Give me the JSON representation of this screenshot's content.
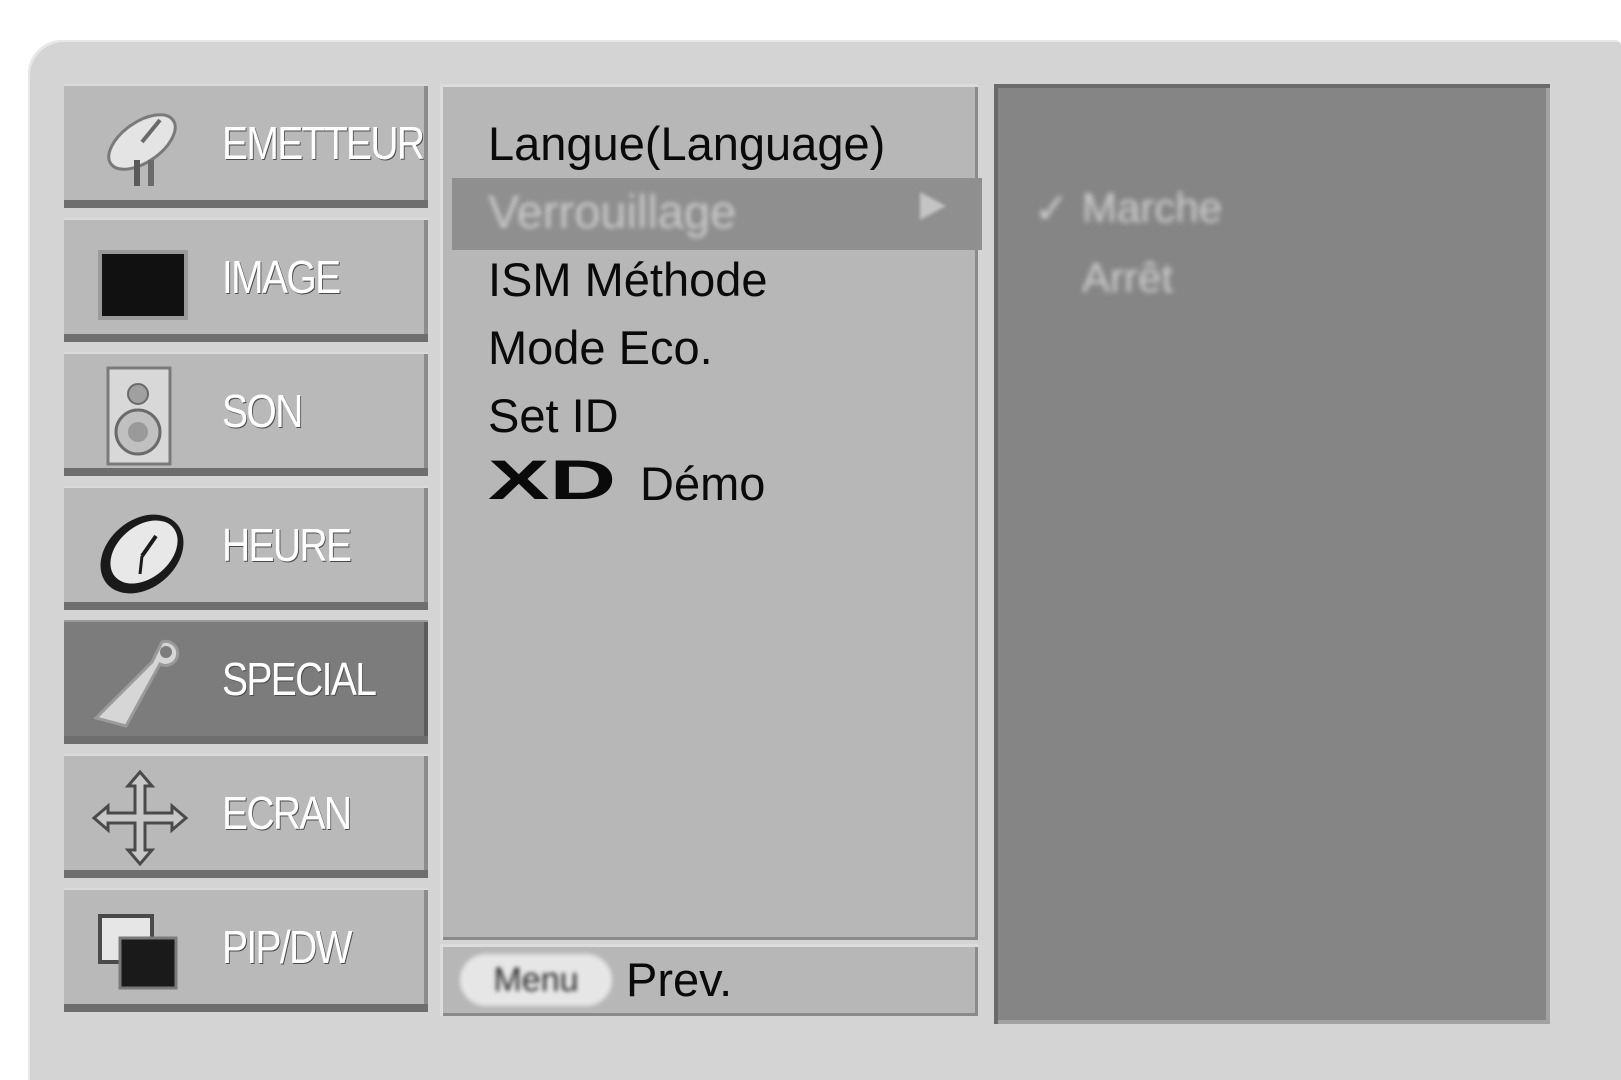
{
  "categories": [
    {
      "label": "EMETTEUR",
      "icon": "satellite-dish-icon",
      "active": false
    },
    {
      "label": "IMAGE",
      "icon": "tv-screen-icon",
      "active": false
    },
    {
      "label": "SON",
      "icon": "speaker-icon",
      "active": false
    },
    {
      "label": "HEURE",
      "icon": "clock-icon",
      "active": false
    },
    {
      "label": "SPECIAL",
      "icon": "tag-icon",
      "active": true
    },
    {
      "label": "ECRAN",
      "icon": "move-arrows-icon",
      "active": false
    },
    {
      "label": "PIP/DW",
      "icon": "pip-windows-icon",
      "active": false
    }
  ],
  "menu": {
    "items": [
      {
        "label": "Langue(Language)"
      },
      {
        "label": "Verrouillage",
        "highlighted": true
      },
      {
        "label": "ISM Méthode"
      },
      {
        "label": "Mode Eco."
      },
      {
        "label": "Set ID"
      },
      {
        "label": "Démo",
        "logo": "XD"
      }
    ]
  },
  "footer": {
    "key_label": "Menu",
    "action_label": "Prev."
  },
  "options": {
    "items": [
      {
        "label": "Marche",
        "checked": true
      },
      {
        "label": "Arrêt",
        "checked": false
      }
    ]
  },
  "colors": {
    "frame": "#d4d4d4",
    "category_bg": "#b9b9b9",
    "category_active_bg": "#7c7c7c",
    "menu_bg": "#b7b7b7",
    "highlight_bg": "#8f8f8f",
    "options_bg": "#858585"
  }
}
